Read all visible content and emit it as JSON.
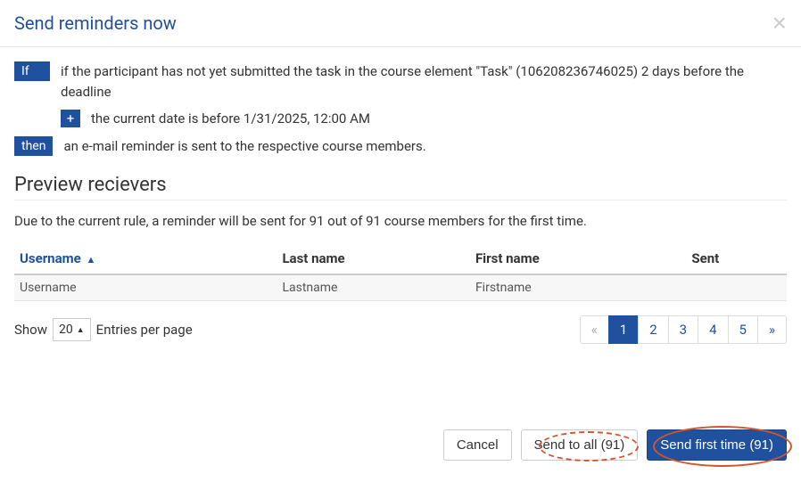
{
  "modal": {
    "title": "Send reminders now",
    "close": "×"
  },
  "rule": {
    "if_label": "If",
    "if_text": "if the participant has not yet submitted the task in the course element \"Task\" (106208236746025) 2 days before the deadline",
    "plus_label": "+",
    "plus_text": "the current date is before 1/31/2025, 12:00 AM",
    "then_label": "then",
    "then_text": "an e-mail reminder is sent to the respective course members."
  },
  "preview": {
    "heading": "Preview recievers",
    "summary": "Due to the current rule, a reminder will be sent for 91 out of 91 course members for the first time."
  },
  "table": {
    "headers": {
      "username": "Username",
      "lastname": "Last name",
      "firstname": "First name",
      "sent": "Sent"
    },
    "rows": [
      {
        "username": "Username",
        "lastname": "Lastname",
        "firstname": "Firstname",
        "sent": ""
      }
    ]
  },
  "pager": {
    "show_label": "Show",
    "per_page_label": "Entries per page",
    "page_size": "20",
    "prev": "«",
    "next": "»",
    "pages": [
      "1",
      "2",
      "3",
      "4",
      "5"
    ],
    "active": "1"
  },
  "actions": {
    "cancel": "Cancel",
    "send_all": "Send to all (91)",
    "send_first": "Send first time (91)"
  }
}
